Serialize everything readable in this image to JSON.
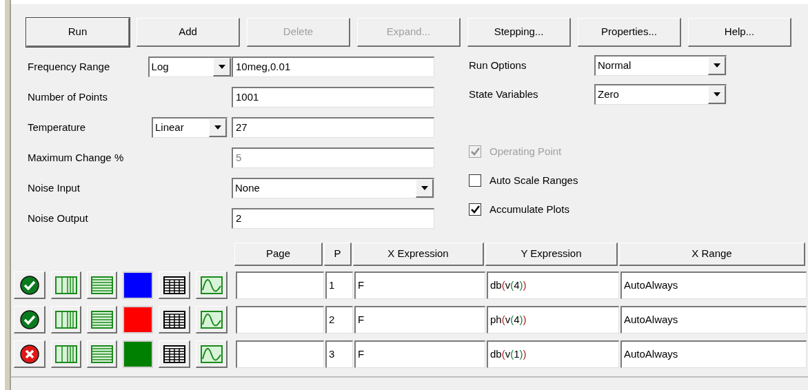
{
  "buttons": [
    {
      "label": "Run",
      "disabled": false,
      "default": true
    },
    {
      "label": "Add",
      "disabled": false,
      "default": false
    },
    {
      "label": "Delete",
      "disabled": true,
      "default": false
    },
    {
      "label": "Expand...",
      "disabled": true,
      "default": false
    },
    {
      "label": "Stepping...",
      "disabled": false,
      "default": false
    },
    {
      "label": "Properties...",
      "disabled": false,
      "default": false
    },
    {
      "label": "Help...",
      "disabled": false,
      "default": false
    }
  ],
  "fields": [
    {
      "label": "Frequency Range",
      "kind": "dropdown_text",
      "mode": "Log",
      "value": "10meg,0.01",
      "disabled": false
    },
    {
      "label": "Number of Points",
      "kind": "text",
      "value": "1001",
      "disabled": false
    },
    {
      "label": "Temperature",
      "kind": "dropdown_text",
      "mode": "Linear",
      "value": "27",
      "disabled": false
    },
    {
      "label": "Maximum Change %",
      "kind": "text",
      "value": "5",
      "disabled": true
    },
    {
      "label": "Noise Input",
      "kind": "dropdown",
      "value": "None",
      "disabled": false
    },
    {
      "label": "Noise Output",
      "kind": "text",
      "value": "2",
      "disabled": false
    }
  ],
  "options": [
    {
      "label": "Run Options",
      "value": "Normal"
    },
    {
      "label": "State Variables",
      "value": "Zero"
    }
  ],
  "checkboxes": [
    {
      "label": "Operating Point",
      "checked": true,
      "disabled": true
    },
    {
      "label": "Auto Scale Ranges",
      "checked": false,
      "disabled": false
    },
    {
      "label": "Accumulate Plots",
      "checked": true,
      "disabled": false
    }
  ],
  "table": {
    "columns": [
      "Page",
      "P",
      "X Expression",
      "Y Expression",
      "X Range"
    ],
    "rows": [
      {
        "enabled": true,
        "color": "#0000ff",
        "page": "",
        "p": "1",
        "x_expression": "F",
        "y_expression": "db(v(4))",
        "x_range": "AutoAlways"
      },
      {
        "enabled": true,
        "color": "#ff0000",
        "page": "",
        "p": "2",
        "x_expression": "F",
        "y_expression": "ph(v(4))",
        "x_range": "AutoAlways"
      },
      {
        "enabled": false,
        "color": "#008000",
        "page": "",
        "p": "3",
        "x_expression": "F",
        "y_expression": "db(v(1))",
        "x_range": "AutoAlways"
      }
    ]
  }
}
